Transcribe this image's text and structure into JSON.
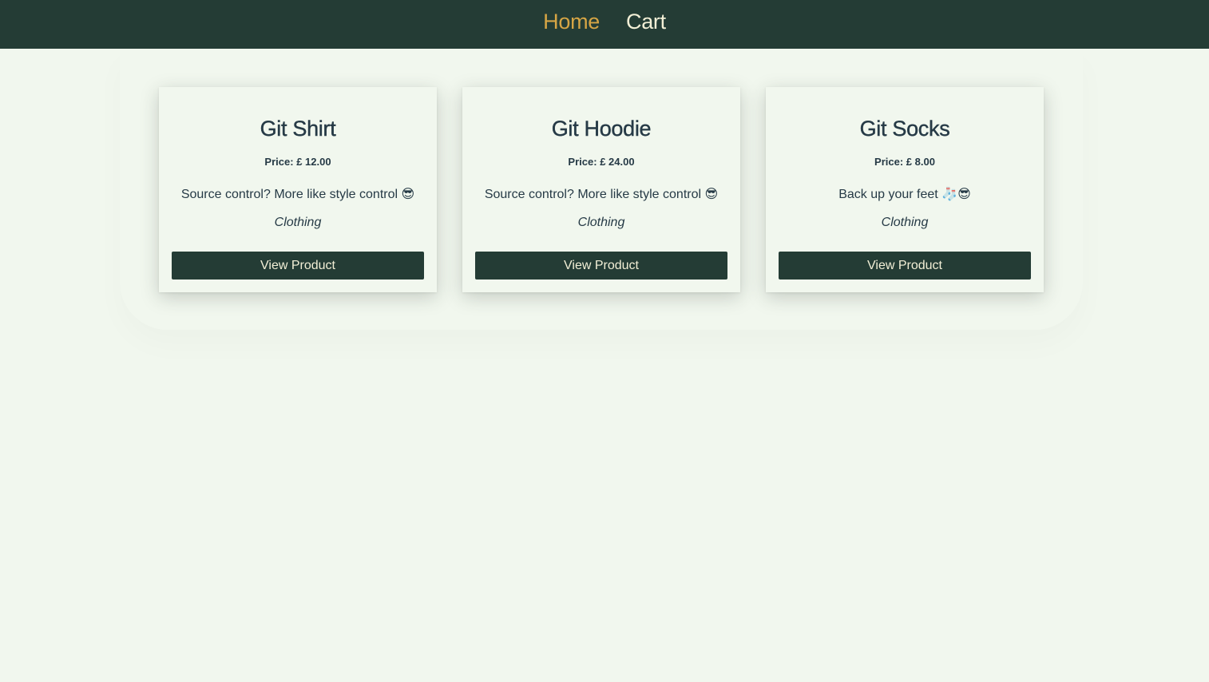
{
  "nav": {
    "home_label": "Home",
    "cart_label": "Cart"
  },
  "colors": {
    "header_bg": "#243c35",
    "page_bg": "#f1f7ee",
    "nav_active": "#d6a545",
    "nav_text": "#f2efd6",
    "text": "#263a46"
  },
  "products": [
    {
      "title": "Git Shirt",
      "price_label": "Price:",
      "price": "£ 12.00",
      "description": "Source control? More like style control 😎",
      "category": "Clothing",
      "button_label": "View Product"
    },
    {
      "title": "Git Hoodie",
      "price_label": "Price:",
      "price": "£ 24.00",
      "description": "Source control? More like style control 😎",
      "category": "Clothing",
      "button_label": "View Product"
    },
    {
      "title": "Git Socks",
      "price_label": "Price:",
      "price": "£ 8.00",
      "description": "Back up your feet 🧦😎",
      "category": "Clothing",
      "button_label": "View Product"
    }
  ]
}
